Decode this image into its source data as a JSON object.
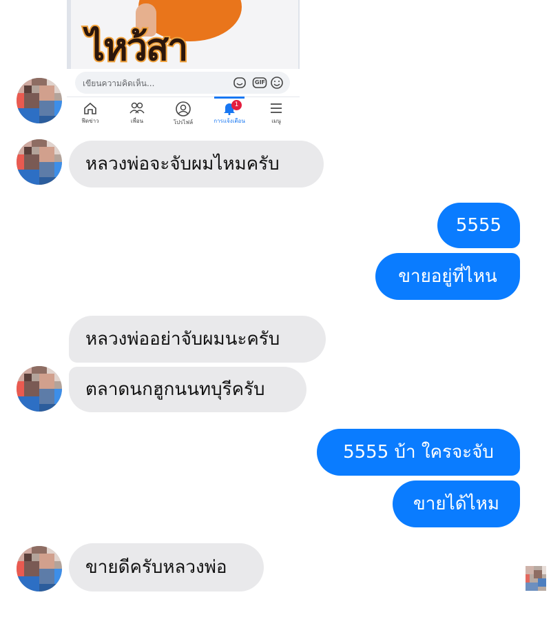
{
  "shared_post": {
    "photo_text": "ไหว้สา",
    "comment_placeholder": "เขียนความคิดเห็น...",
    "comment_icons": [
      "sticker-icon",
      "gif-icon",
      "emoji-icon"
    ],
    "gif_label": "GIF",
    "nav": [
      {
        "label": "ฟีดข่าว",
        "icon": "home-icon"
      },
      {
        "label": "เพื่อน",
        "icon": "friends-icon"
      },
      {
        "label": "โปรไฟล์",
        "icon": "profile-icon"
      },
      {
        "label": "การแจ้งเตือน",
        "icon": "bell-icon",
        "badge": "1",
        "active": true
      },
      {
        "label": "เมนู",
        "icon": "menu-icon"
      }
    ]
  },
  "messages": [
    {
      "side": "incoming",
      "text": "หลวงพ่อจะจับผมไหมครับ"
    },
    {
      "side": "outgoing",
      "text": "5555"
    },
    {
      "side": "outgoing",
      "text": "ขายอยู่ที่ไหน"
    },
    {
      "side": "incoming",
      "text": "หลวงพ่ออย่าจับผมนะครับ"
    },
    {
      "side": "incoming",
      "text": "ตลาดนกฮูกนนทบุรีครับ"
    },
    {
      "side": "outgoing",
      "text": "5555 บ้า ใครจะจับ"
    },
    {
      "side": "outgoing",
      "text": "ขายได้ไหม"
    },
    {
      "side": "incoming",
      "text": "ขายดีครับหลวงพ่อ"
    }
  ],
  "colors": {
    "outgoing_bubble": "#0a7cff",
    "incoming_bubble": "#e9e9eb",
    "facebook_blue": "#1877f2",
    "notification_badge": "#e41e3f"
  }
}
